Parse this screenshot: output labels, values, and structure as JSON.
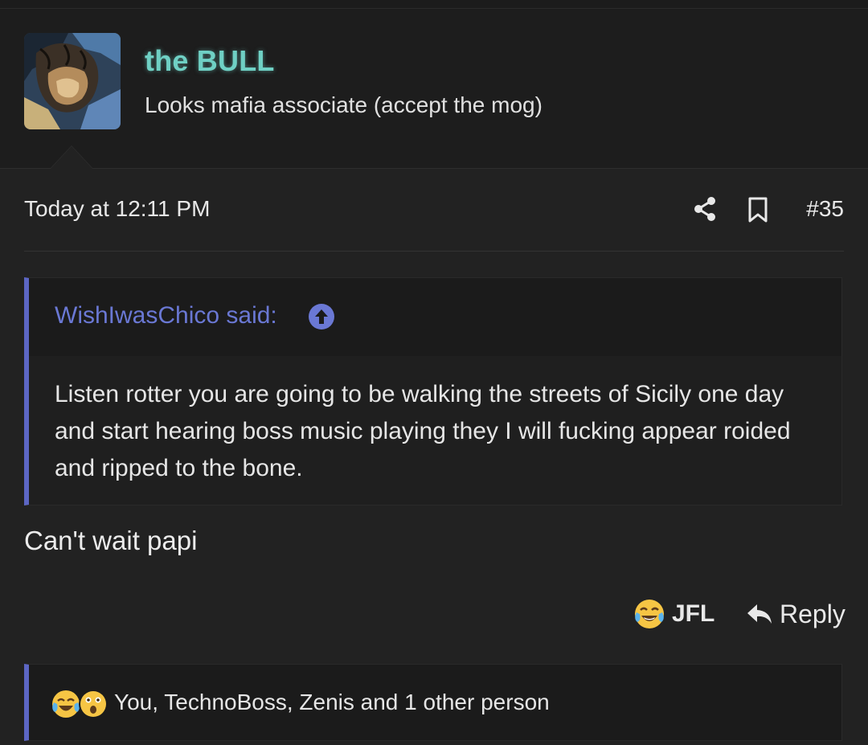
{
  "post": {
    "username": "the BULL",
    "user_title": "Looks mafia associate (accept the mog)",
    "date": "Today at 12:11 PM",
    "number": "#35",
    "quote": {
      "author_label": "WishIwasChico said:",
      "text": "Listen rotter you are going to be walking the streets of Sicily one day and start hearing boss music playing they I will fucking appear roided and ripped to the bone."
    },
    "body": "Can't wait papi",
    "actions": {
      "reaction_label": "JFL",
      "reply_label": "Reply"
    },
    "reactions_summary": "You, TechnoBoss, Zenis and 1 other person"
  },
  "icons": {
    "share": "share-icon",
    "bookmark": "bookmark-icon",
    "quote_jump": "arrow-up-circle-icon",
    "reaction": "crying-laughing-emoji",
    "reply": "reply-arrow-icon",
    "reaction_summary_icons": [
      "crying-laughing-emoji",
      "astonished-emoji"
    ]
  },
  "colors": {
    "username": "#6fd0c4",
    "quote_accent": "#5c66c4",
    "quote_author": "#6a78d4",
    "background": "#222222"
  }
}
